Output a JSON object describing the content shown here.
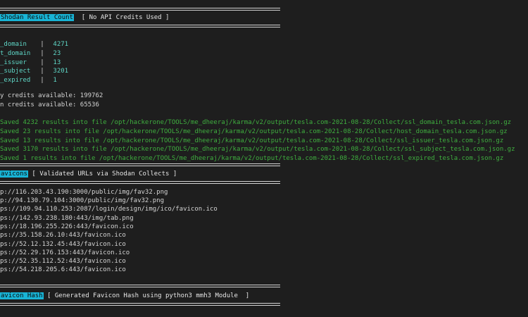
{
  "section1": {
    "title": "Shodan Result Count",
    "note": "[ No API Credits Used ]"
  },
  "counts": [
    {
      "key": "_domain",
      "value": "4271"
    },
    {
      "key": "t_domain",
      "value": "23"
    },
    {
      "key": "_issuer",
      "value": "13"
    },
    {
      "key": "_subject",
      "value": "3201"
    },
    {
      "key": "_expired",
      "value": "1"
    }
  ],
  "credits": {
    "query": "y credits available: 199762",
    "scan": "n credits available: 65536"
  },
  "saved": [
    "Saved 4232 results into file /opt/hackerone/TOOLS/me_dheeraj/karma/v2/output/tesla.com-2021-08-28/Collect/ssl_domain_tesla.com.json.gz",
    "Saved 23 results into file /opt/hackerone/TOOLS/me_dheeraj/karma/v2/output/tesla.com-2021-08-28/Collect/host_domain_tesla.com.json.gz",
    "Saved 13 results into file /opt/hackerone/TOOLS/me_dheeraj/karma/v2/output/tesla.com-2021-08-28/Collect/ssl_issuer_tesla.com.json.gz",
    "Saved 3170 results into file /opt/hackerone/TOOLS/me_dheeraj/karma/v2/output/tesla.com-2021-08-28/Collect/ssl_subject_tesla.com.json.gz",
    "Saved 1 results into file /opt/hackerone/TOOLS/me_dheeraj/karma/v2/output/tesla.com-2021-08-28/Collect/ssl_expired_tesla.com.json.gz"
  ],
  "section2": {
    "title": "avicons",
    "note": "[ Validated URLs via Shodan Collects ]"
  },
  "urls": [
    "p://116.203.43.190:3000/public/img/fav32.png",
    "p://94.130.79.104:3000/public/img/fav32.png",
    "ps://109.94.110.253:2087/login/design/img/ico/favicon.ico",
    "ps://142.93.238.180:443/img/tab.png",
    "ps://18.196.255.226:443/favicon.ico",
    "ps://35.158.26.10:443/favicon.ico",
    "ps://52.12.132.45:443/favicon.ico",
    "ps://52.29.176.153:443/favicon.ico",
    "ps://52.35.112.52:443/favicon.ico",
    "ps://54.218.205.6:443/favicon.ico"
  ],
  "section3": {
    "title": "avicon Hash",
    "note": "[ Generated Favicon Hash using python3 mmh3 Module  ]"
  },
  "colors": {
    "background": "#1e1e1e",
    "highlight": "#18b4d6",
    "cyan": "#5fd7c7",
    "green": "#3fae3f"
  }
}
